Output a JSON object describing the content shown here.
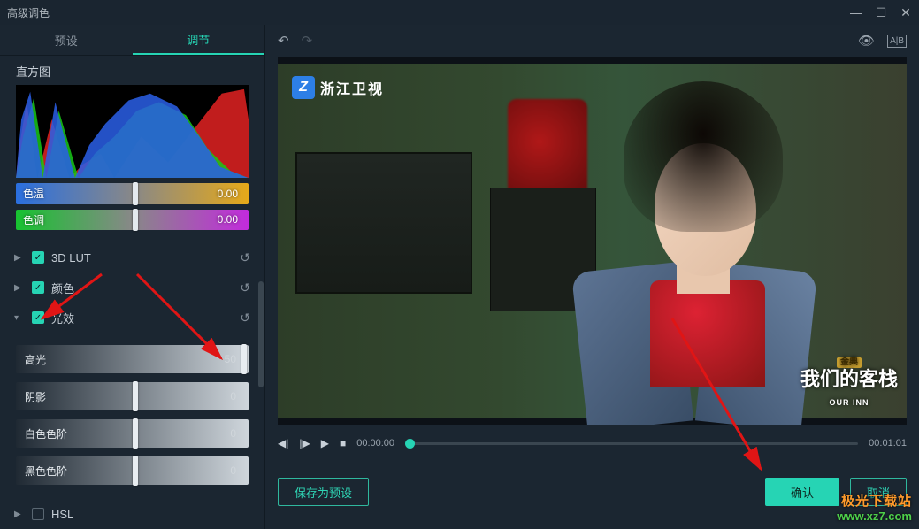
{
  "window": {
    "title": "高级调色"
  },
  "tabs": {
    "preset": "预设",
    "adjust": "调节"
  },
  "histogram_label": "直方图",
  "sliders": {
    "temp": {
      "label": "色温",
      "value": "0.00"
    },
    "tint": {
      "label": "色调",
      "value": "0.00"
    }
  },
  "sections": {
    "lut": "3D LUT",
    "color": "颜色",
    "light": "光效",
    "hsl": "HSL"
  },
  "light_sliders": {
    "highlight": {
      "label": "高光",
      "value": "50"
    },
    "shadow": {
      "label": "阴影",
      "value": "0"
    },
    "white": {
      "label": "白色色阶",
      "value": "0"
    },
    "black": {
      "label": "黑色色阶",
      "value": "0"
    }
  },
  "playback": {
    "current": "00:00:00",
    "total": "00:01:01"
  },
  "preview": {
    "channel_logo": "Z",
    "channel_text": "浙江卫视",
    "corner_small": "金典",
    "corner_main": "我们的客栈",
    "corner_sub": "OUR INN"
  },
  "buttons": {
    "save_preset": "保存为预设",
    "confirm": "确认",
    "cancel": "取消"
  },
  "watermark": {
    "line1": "极光下载站",
    "line2": "www.xz7.com"
  }
}
